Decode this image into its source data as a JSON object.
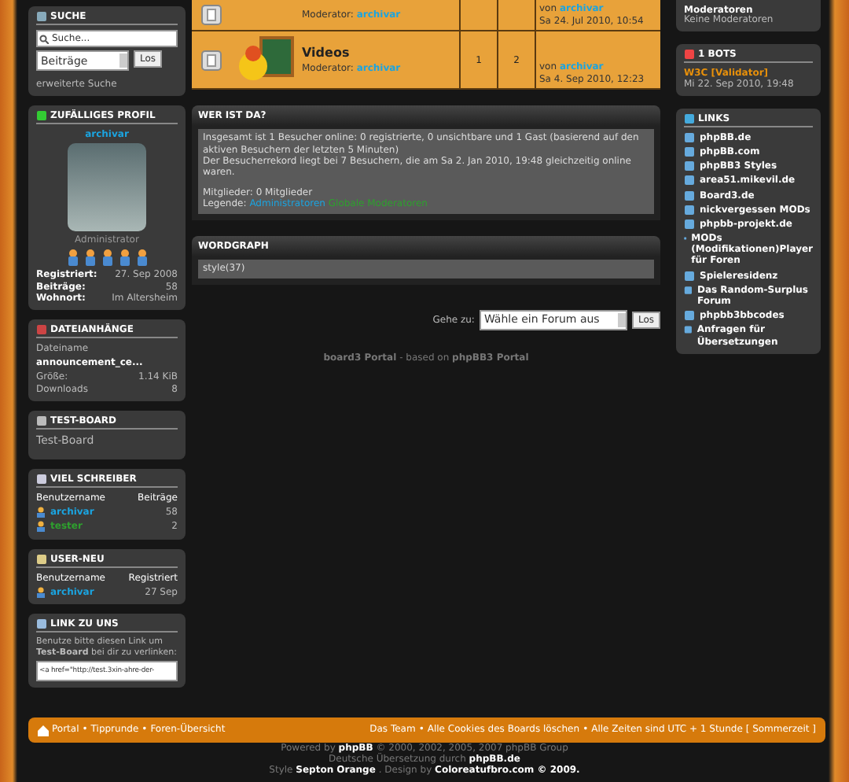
{
  "left": {
    "search": {
      "title": "SUCHE",
      "placeholder": "Suche...",
      "select": "Beiträge",
      "button": "Los",
      "link": "erweiterte Suche"
    },
    "profile": {
      "title": "ZUFÄLLIGES PROFIL",
      "name": "archivar",
      "rank": "Administrator",
      "stars": 5,
      "rows": [
        {
          "label": "Registriert:",
          "value": "27. Sep 2008"
        },
        {
          "label": "Beiträge:",
          "value": "58"
        },
        {
          "label": "Wohnort:",
          "value": "Im Altersheim"
        }
      ]
    },
    "attachments": {
      "title": "DATEIANHÄNGE",
      "name_label": "Dateiname",
      "file": "announcement_ce...",
      "rows": [
        {
          "label": "Größe:",
          "value": "1.14 KiB"
        },
        {
          "label": "Downloads",
          "value": "8"
        }
      ]
    },
    "board": {
      "title": "TEST-BOARD",
      "text": "Test-Board"
    },
    "posters": {
      "title": "VIEL SCHREIBER",
      "columns": [
        "Benutzername",
        "Beiträge"
      ],
      "rows": [
        {
          "name": "archivar",
          "value": "58",
          "color": "#1ba4e0"
        },
        {
          "name": "tester",
          "value": "2",
          "color": "#2ea02e"
        }
      ]
    },
    "newusers": {
      "title": "USER-NEU",
      "columns": [
        "Benutzername",
        "Registriert"
      ],
      "rows": [
        {
          "name": "archivar",
          "value": "27 Sep",
          "color": "#1ba4e0"
        }
      ]
    },
    "linkus": {
      "title": "LINK ZU UNS",
      "text": "Benutze bitte diesen Link um **Test-Board** bei dir zu verlinken:",
      "code": "<a href=\"http://test.3xin-ahre-der-"
    }
  },
  "forums": [
    {
      "moderator_label": "Moderator:",
      "moderator": "archivar",
      "by": "von",
      "last_user": "archivar",
      "last_date": "Sa 24. Jul 2010, 10:54"
    },
    {
      "name": "Videos",
      "moderator_label": "Moderator:",
      "moderator": "archivar",
      "topics": "1",
      "posts": "2",
      "by": "von",
      "last_user": "archivar",
      "last_date": "Sa 4. Sep 2010, 12:23"
    }
  ],
  "online": {
    "title": "WER IST DA?",
    "lines": [
      "Insgesamt ist 1 Besucher online: 0 registrierte, 0 unsichtbare und 1 Gast (basierend auf den aktiven Besuchern der letzten 5 Minuten)",
      "Der Besucherrekord liegt bei 7 Besuchern, die am Sa 2. Jan 2010, 19:48 gleichzeitig online waren.",
      "Mitglieder: 0 Mitglieder"
    ],
    "legend_label": "Legende:",
    "groups": [
      {
        "name": "Administratoren",
        "color": "#1ba4e0"
      },
      {
        "name": "Globale Moderatoren",
        "color": "#2ea02e"
      }
    ]
  },
  "wordgraph": {
    "title": "WORDGRAPH",
    "text": "style(37)"
  },
  "jump": {
    "label": "Gehe zu:",
    "select": "Wähle ein Forum aus",
    "button": "Los"
  },
  "portal_credit": "**board3 Portal** - based on **phpBB3 Portal**",
  "right": {
    "mods": {
      "title": "Moderatoren",
      "text": "Keine Moderatoren"
    },
    "bots": {
      "title": "1 BOTS",
      "bot": "W3C [Validator]",
      "date": "Mi 22. Sep 2010, 19:48"
    },
    "links": {
      "title": "LINKS",
      "items": [
        "phpBB.de",
        "phpBB.com",
        "phpBB3 Styles",
        "area51.mikevil.de",
        "Board3.de",
        "nickvergessen MODs",
        "phpbb-projekt.de",
        "MODs (Modifikationen)Player für Foren",
        "Spieleresidenz",
        "Das Random-Surplus Forum",
        "phpbb3bbcodes",
        "Anfragen für Übersetzungen"
      ]
    }
  },
  "footer": {
    "left": [
      "Portal",
      "Tipprunde",
      "Foren-Übersicht"
    ],
    "separator": "•",
    "right": [
      "Das Team",
      "Alle Cookies des Boards löschen"
    ],
    "time": "Alle Zeiten sind UTC + 1 Stunde [ Sommerzeit ]"
  },
  "credits": [
    "Powered by **phpBB** © 2000, 2002, 2005, 2007 phpBB Group",
    "Deutsche Übersetzung durch **phpBB.de**",
    "Style **Septon Orange** . Design by **Coloreatufbro.com © 2009.**"
  ]
}
